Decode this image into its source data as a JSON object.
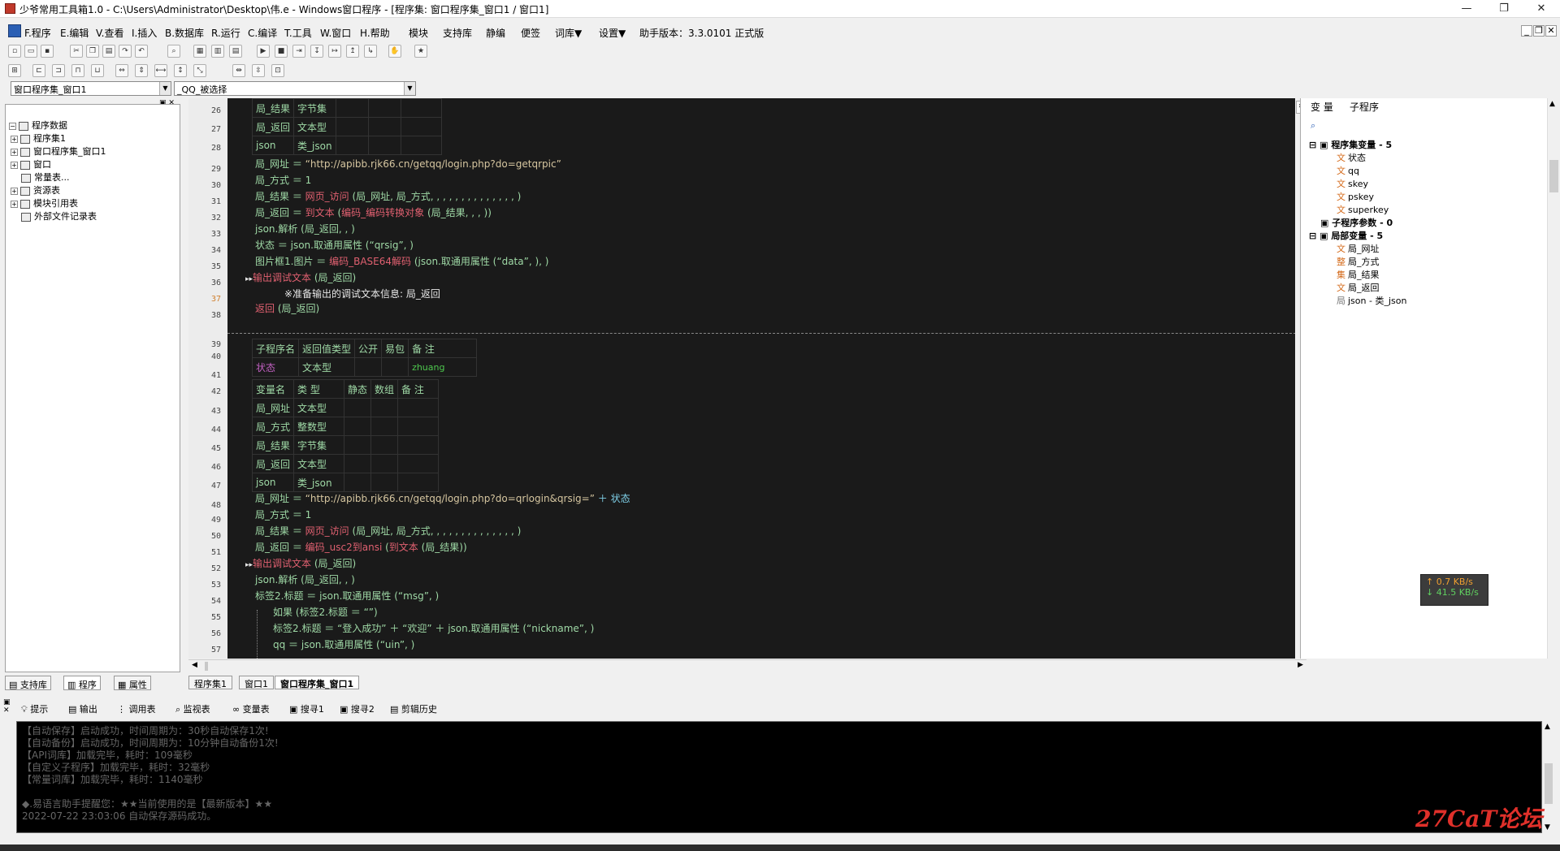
{
  "window": {
    "title": "少爷常用工具箱1.0 - C:\\Users\\Administrator\\Desktop\\伟.e - Windows窗口程序 - [程序集: 窗口程序集_窗口1 / 窗口1]",
    "min": "—",
    "max": "❐",
    "close": "✕"
  },
  "menu": {
    "items": [
      "F.程序",
      "E.编辑",
      "V.查看",
      "I.插入",
      "B.数据库",
      "R.运行",
      "C.编译",
      "T.工具",
      "W.窗口",
      "H.帮助",
      "模块",
      "支持库",
      "静编",
      "便签",
      "词库▼",
      "设置▼",
      "助手版本：3.3.0101 正式版"
    ],
    "mdi": [
      "_",
      "❐",
      "✕"
    ]
  },
  "combos": {
    "program_set": "窗口程序集_窗口1",
    "subprogram": "_QQ_被选择"
  },
  "left_tree": {
    "root": "程序数据",
    "items": [
      "程序集1",
      "窗口程序集_窗口1",
      "窗口",
      "常量表...",
      "资源表",
      "模块引用表",
      "外部文件记录表"
    ]
  },
  "left_tabs": [
    "支持库",
    "程序",
    "属性"
  ],
  "editor": {
    "line_numbers": [
      "26",
      "27",
      "28",
      "29",
      "30",
      "31",
      "32",
      "33",
      "34",
      "35",
      "36",
      "37",
      "38",
      "39",
      "40",
      "41",
      "42",
      "43",
      "44",
      "45",
      "46",
      "47",
      "48",
      "49",
      "50",
      "51",
      "52",
      "53",
      "54",
      "55",
      "56",
      "57"
    ],
    "var_table_top": [
      [
        "局_结果",
        "字节集"
      ],
      [
        "局_返回",
        "文本型"
      ],
      [
        "json",
        "类_json"
      ]
    ],
    "lines_a": [
      {
        "prefix": "局_网址 ＝ ",
        "str": "“http://apibb.rjk66.cn/getqq/login.php?do=getqrpic”"
      },
      {
        "text": "局_方式 ＝ 1"
      },
      {
        "prefix": "局_结果 ＝ ",
        "fn": "网页_访问",
        "rest": " (局_网址, 局_方式, , , , , , , , , , , , , , )"
      },
      {
        "prefix": "局_返回 ＝ ",
        "fn": "到文本",
        "rest": " (",
        "fn2": "编码_编码转换对象",
        "rest2": " (局_结果, , , ))"
      },
      {
        "text": "json.解析 (局_返回, , )"
      },
      {
        "text": "状态 ＝ json.取通用属性 (“qrsig”, )"
      },
      {
        "prefix": "图片框1.图片 ＝ ",
        "fn": "编码_BASE64解码",
        "rest": " (json.取通用属性 (“data”, ), )"
      },
      {
        "fn": "输出调试文本",
        "rest": " (局_返回)"
      },
      {
        "note": "※准备输出的调试文本信息: 局_返回"
      },
      {
        "fn": "返回",
        "rest": " (局_返回)"
      }
    ],
    "sub_header": [
      "子程序名",
      "返回值类型",
      "公开",
      "易包",
      "备 注"
    ],
    "sub_row": [
      "状态",
      "文本型",
      "",
      "",
      "zhuang"
    ],
    "var_header": [
      "变量名",
      "类 型",
      "静态",
      "数组",
      "备 注"
    ],
    "var_rows": [
      [
        "局_网址",
        "文本型"
      ],
      [
        "局_方式",
        "整数型"
      ],
      [
        "局_结果",
        "字节集"
      ],
      [
        "局_返回",
        "文本型"
      ],
      [
        "json",
        "类_json"
      ]
    ],
    "lines_b": [
      {
        "prefix": "局_网址 ＝ ",
        "str": "“http://apibb.rjk66.cn/getqq/login.php?do=qrlogin&qrsig=”",
        "rest": " ＋ 状态"
      },
      {
        "text": "局_方式 ＝ 1"
      },
      {
        "prefix": "局_结果 ＝ ",
        "fn": "网页_访问",
        "rest": " (局_网址, 局_方式, , , , , , , , , , , , , , )"
      },
      {
        "prefix": "局_返回 ＝ ",
        "fn": "编码_usc2到ansi",
        "rest": " (",
        "fn2": "到文本",
        "rest2": " (局_结果))"
      },
      {
        "fn": "输出调试文本",
        "rest": " (局_返回)"
      },
      {
        "text": "json.解析 (局_返回, , )"
      },
      {
        "text": "标签2.标题 ＝ json.取通用属性 (“msg”, )"
      },
      {
        "text": "如果 (标签2.标题 ＝ “”)"
      },
      {
        "text": "标签2.标题 ＝ “登入成功” ＋ “欢迎” ＋ json.取通用属性 (“nickname”, )"
      },
      {
        "text": "qq ＝ json.取通用属性 (“uin”, )"
      }
    ]
  },
  "right_panel": {
    "tabs": [
      "变 量",
      "子程序"
    ],
    "groups": [
      {
        "title": "程序集变量 - 5",
        "items": [
          {
            "tag": "文",
            "name": "状态"
          },
          {
            "tag": "文",
            "name": "qq"
          },
          {
            "tag": "文",
            "name": "skey"
          },
          {
            "tag": "文",
            "name": "pskey"
          },
          {
            "tag": "文",
            "name": "superkey"
          }
        ]
      },
      {
        "title": "子程序参数 - 0",
        "items": []
      },
      {
        "title": "局部变量 - 5",
        "items": [
          {
            "tag": "文",
            "name": "局_网址"
          },
          {
            "tag": "整",
            "name": "局_方式"
          },
          {
            "tag": "集",
            "name": "局_结果"
          },
          {
            "tag": "文",
            "name": "局_返回"
          },
          {
            "tag": "局",
            "name": "json - 类_json"
          }
        ]
      }
    ]
  },
  "netmon": {
    "up": "↑ 0.7 KB/s",
    "down": "↓ 41.5 KB/s"
  },
  "doc_tabs": [
    "程序集1",
    "窗口1",
    "窗口程序集_窗口1"
  ],
  "bottom_tabs": [
    "提示",
    "输出",
    "调用表",
    "监视表",
    "变量表",
    "搜寻1",
    "搜寻2",
    "剪辑历史"
  ],
  "output_lines": [
    "【自动保存】启动成功，时间周期为：30秒自动保存1次!",
    "【自动备份】启动成功，时间周期为：10分钟自动备份1次!",
    "【API词库】加载完毕，耗时：109毫秒",
    "【自定义子程序】加载完毕，耗时：32毫秒",
    "【常量词库】加载完毕，耗时：1140毫秒",
    "",
    "◆.易语言助手提醒您：★★当前使用的是【最新版本】★★",
    "2022-07-22 23:03:06 自动保存源码成功。"
  ],
  "watermark": "27CaT论坛"
}
